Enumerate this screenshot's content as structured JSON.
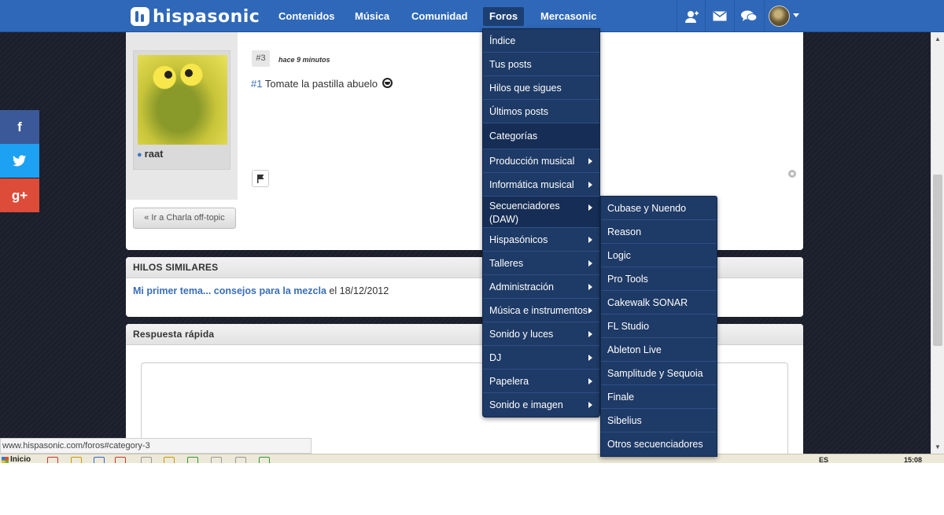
{
  "colors": {
    "nav_bg": "#2f68b8",
    "menu_bg": "#1e3a66",
    "link": "#3a6fb5",
    "facebook": "#3b5998",
    "twitter": "#1da1f2",
    "gplus": "#dd4b39"
  },
  "header": {
    "logo_text": "hispasonic",
    "nav": [
      "Contenidos",
      "Música",
      "Comunidad",
      "Foros",
      "Mercasonic"
    ],
    "active_nav": "Foros",
    "icons": [
      "user-add-icon",
      "mail-icon",
      "chat-icon",
      "avatar",
      "chevron-down-icon"
    ]
  },
  "post": {
    "number": "#3",
    "time": "hace 9 minutos",
    "ref": "#1",
    "text": "Tomate la pastilla abuelo",
    "username": "raat",
    "back_label": "« Ir a Charla off-topic"
  },
  "similar": {
    "header": "HILOS SIMILARES",
    "link": "Mi primer tema... consejos para la mezcla",
    "date_text": "el 18/12/2012"
  },
  "reply": {
    "header": "Respuesta rápida"
  },
  "social": [
    "f",
    "twitter-bird",
    "g+"
  ],
  "forum_menu": {
    "items": [
      "Índice",
      "Tus posts",
      "Hilos que sigues",
      "Últimos posts"
    ],
    "heading": "Categorías",
    "categories": [
      "Producción musical",
      "Informática musical",
      "Secuenciadores (DAW)",
      "Hispasónicos",
      "Talleres",
      "Administración",
      "Música e instrumentos",
      "Sonido y luces",
      "DJ",
      "Papelera",
      "Sonido e imagen"
    ],
    "active_category": "Secuenciadores (DAW)"
  },
  "daw_menu": {
    "items": [
      "Cubase y Nuendo",
      "Reason",
      "Logic",
      "Pro Tools",
      "Cakewalk SONAR",
      "FL Studio",
      "Ableton Live",
      "Samplitude y Sequoia",
      "Finale",
      "Sibelius",
      "Otros secuenciadores"
    ]
  },
  "status_url": "www.hispasonic.com/foros#category-3",
  "taskbar": {
    "start_label": "Inicio",
    "lang": "ES",
    "clock": "15:08"
  }
}
